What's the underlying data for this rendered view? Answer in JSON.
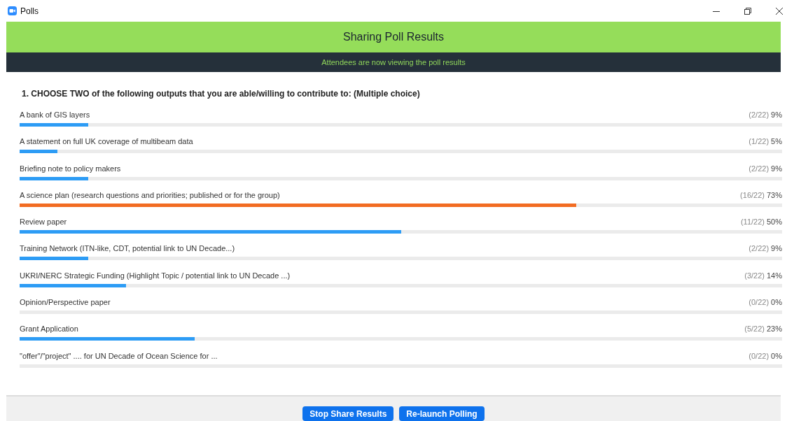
{
  "window": {
    "title": "Polls"
  },
  "banner": {
    "title": "Sharing Poll Results",
    "subtitle": "Attendees are now viewing the poll results"
  },
  "question": "1. CHOOSE TWO of the following outputs that you are able/willing to contribute to: (Multiple choice)",
  "answers": [
    {
      "label": "A bank of GIS layers",
      "count": "(2/22)",
      "percent": "9%",
      "level": 0.09,
      "color": "#2d9cf5"
    },
    {
      "label": "A statement on full UK coverage of multibeam data",
      "count": "(1/22)",
      "percent": "5%",
      "level": 0.05,
      "color": "#2d9cf5"
    },
    {
      "label": "Briefing note to policy makers",
      "count": "(2/22)",
      "percent": "9%",
      "level": 0.09,
      "color": "#2d9cf5"
    },
    {
      "label": "A science plan (research questions and priorities; published or for the group)",
      "count": "(16/22)",
      "percent": "73%",
      "level": 0.73,
      "color": "#f26c22"
    },
    {
      "label": "Review paper",
      "count": "(11/22)",
      "percent": "50%",
      "level": 0.5,
      "color": "#2d9cf5"
    },
    {
      "label": "Training Network (ITN-like, CDT, potential link to UN Decade...)",
      "count": "(2/22)",
      "percent": "9%",
      "level": 0.09,
      "color": "#2d9cf5"
    },
    {
      "label": "UKRI/NERC Strategic Funding (Highlight Topic / potential link to UN Decade ...)",
      "count": "(3/22)",
      "percent": "14%",
      "level": 0.14,
      "color": "#2d9cf5"
    },
    {
      "label": "Opinion/Perspective paper",
      "count": "(0/22)",
      "percent": "0%"
    },
    {
      "label": "Grant Application",
      "count": "(5/22)",
      "percent": "23%",
      "level": 0.23,
      "color": "#2d9cf5"
    },
    {
      "label": "\"offer\"/\"project\" .... for UN Decade of Ocean Science for ...",
      "count": "(0/22)",
      "percent": "0%"
    }
  ],
  "buttons": [
    "Stop Share Results",
    "Re-launch Polling"
  ]
}
